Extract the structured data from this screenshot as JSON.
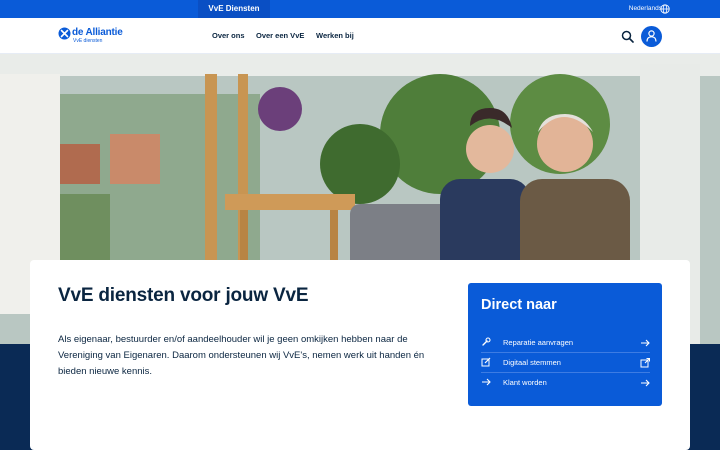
{
  "topbar": {
    "active_tab": "VvE Diensten",
    "language": "Nederlands",
    "language_icon": "globe-icon"
  },
  "header": {
    "logo": {
      "name": "de Alliantie",
      "sub": "VvE diensten"
    },
    "nav": [
      "Over ons",
      "Over een VvE",
      "Werken bij"
    ],
    "icons": [
      "search-icon",
      "user-icon"
    ]
  },
  "colors": {
    "brand_blue": "#0a5bd8",
    "navy": "#0a2a55",
    "text": "#0a2540"
  },
  "main": {
    "title": "VvE diensten voor jouw VvE",
    "intro": "Als eigenaar, bestuurder en/of aandeelhouder wil je geen omkijken hebben naar de Vereniging van Eigenaren. Daarom ondersteunen wij VvE's, nemen werk uit handen én bieden nieuwe kennis."
  },
  "direct": {
    "title": "Direct naar",
    "items": [
      {
        "label": "Reparatie aanvragen",
        "icon": "wrench-icon",
        "action": "arrow-right-icon"
      },
      {
        "label": "Digitaal stemmen",
        "icon": "edit-icon",
        "action": "external-link-icon"
      },
      {
        "label": "Klant worden",
        "icon": "arrow-right-icon",
        "action": "arrow-right-icon"
      }
    ]
  }
}
